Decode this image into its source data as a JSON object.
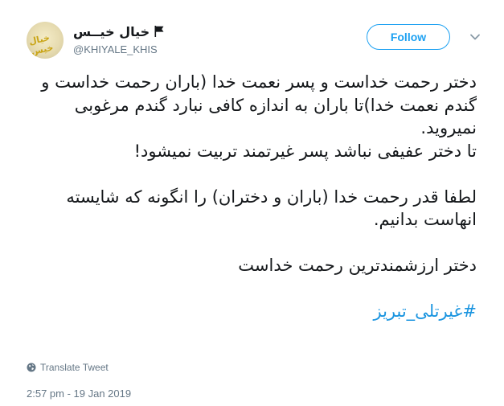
{
  "author": {
    "display_name": "خیال خیــس",
    "handle": "@KHIYALE_KHIS",
    "avatar_text": "خیال خیس"
  },
  "actions": {
    "follow_label": "Follow"
  },
  "tweet": {
    "lines": [
      "دختر رحمت خداست و پسر نعمت خدا (باران رحمت خداست و گندم نعمت خدا)تا باران به اندازه کافی نبارد گندم مرغوبی نمیروید.",
      "تا دختر عفیفی نباشد پسر غیرتمند تربیت نمیشود!",
      "",
      "لطفا قدر رحمت خدا (باران و دختران) را انگونه که شایسته انهاست بدانیم.",
      "",
      "دختر ارزشمندترین رحمت خداست",
      ""
    ],
    "hashtag": "#غیرتلی_تبریز"
  },
  "footer": {
    "translate_label": "Translate Tweet",
    "timestamp": "2:57 pm - 19 Jan 2019"
  },
  "colors": {
    "accent": "#1da1f2",
    "hashtag": "#1b95e0",
    "muted": "#657786",
    "text": "#14171a"
  },
  "icons": [
    "flag-icon",
    "chevron-down-icon",
    "globe-icon"
  ]
}
